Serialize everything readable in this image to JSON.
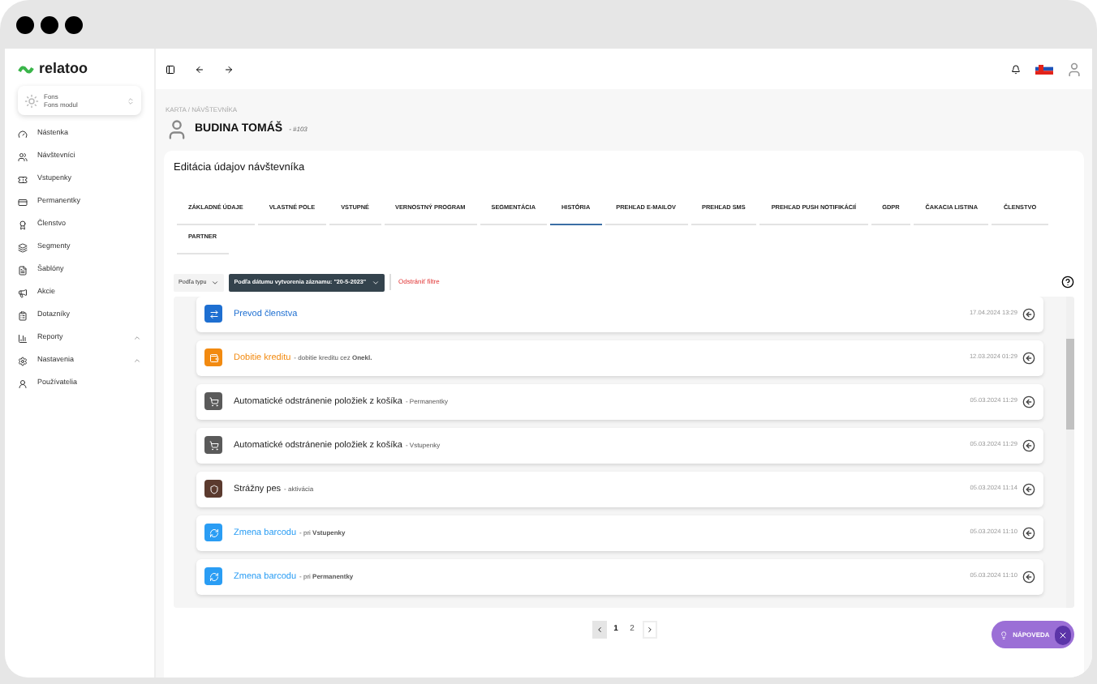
{
  "logo": {
    "text": "relatoo"
  },
  "module_switcher": {
    "title": "Fons",
    "subtitle": "Fons modul"
  },
  "sidebar": {
    "items": [
      {
        "label": "Nástenka",
        "expandable": false
      },
      {
        "label": "Návštevníci",
        "expandable": false
      },
      {
        "label": "Vstupenky",
        "expandable": false
      },
      {
        "label": "Permanentky",
        "expandable": false
      },
      {
        "label": "Členstvo",
        "expandable": false
      },
      {
        "label": "Segmenty",
        "expandable": false
      },
      {
        "label": "Šablóny",
        "expandable": false
      },
      {
        "label": "Akcie",
        "expandable": false
      },
      {
        "label": "Dotazníky",
        "expandable": false
      },
      {
        "label": "Reporty",
        "expandable": true
      },
      {
        "label": "Nastavenia",
        "expandable": true
      },
      {
        "label": "Používatelia",
        "expandable": false
      }
    ]
  },
  "breadcrumb": "KARTA / NÁVŠTEVNÍKA",
  "person": {
    "name": "BUDINA TOMÁŠ",
    "id": "- #103"
  },
  "card": {
    "title": "Editácia údajov návštevníka",
    "tabs": [
      {
        "label": "ZÁKLADNÉ ÚDAJE",
        "selected": false
      },
      {
        "label": "VLASTNÉ POLE",
        "selected": false
      },
      {
        "label": "VSTUPNÉ",
        "selected": false
      },
      {
        "label": "VERNOSTNÝ PROGRAM",
        "selected": false
      },
      {
        "label": "SEGMENTÁCIA",
        "selected": false
      },
      {
        "label": "HISTÓRIA",
        "selected": true
      },
      {
        "label": "PREHĽAD E-MAILOV",
        "selected": false
      },
      {
        "label": "PREHĽAD SMS",
        "selected": false
      },
      {
        "label": "PREHĽAD PUSH NOTIFIKÁCIÍ",
        "selected": false
      },
      {
        "label": "GDPR",
        "selected": false
      },
      {
        "label": "ČAKACIA LISTINA",
        "selected": false
      },
      {
        "label": "ČLENSTVO",
        "selected": false
      },
      {
        "label": "PARTNER",
        "selected": false
      }
    ],
    "filters": [
      {
        "label": "Podľa typu",
        "active": false
      },
      {
        "label": "Podľa dátumu vytvorenia záznamu: \"20-5-2023\"",
        "active": true
      }
    ],
    "remove_filters": "Odstrániť filtre",
    "history": [
      {
        "title": "Prevod členstva",
        "date": "17.04.2024 13:29",
        "color": "#1e6fd1",
        "kind": "colored"
      },
      {
        "title": "Dobitie kreditu",
        "detail": "- dobitie kreditu cez **Onekl.**",
        "date": "12.03.2024 01:29",
        "color": "#f28a10",
        "kind": "colored"
      },
      {
        "title": "Automatické odstránenie položiek z košíka",
        "detail": "- Permanentky",
        "date": "05.03.2024 11:29",
        "color": "#5a5a5a",
        "kind": "plain"
      },
      {
        "title": "Automatické odstránenie položiek z košíka",
        "detail": "- Vstupenky",
        "date": "05.03.2024 11:29",
        "color": "#5a5a5a",
        "kind": "plain"
      },
      {
        "title": "Strážny pes",
        "detail": "- aktivácia",
        "date": "05.03.2024 11:14",
        "color": "#5b3a2e",
        "kind": "plain"
      },
      {
        "title": "Zmena barcodu",
        "detail": "- pri **Vstupenky**",
        "date": "05.03.2024 11:10",
        "color": "#2a9df4",
        "kind": "colored"
      },
      {
        "title": "Zmena barcodu",
        "detail": "- pri **Permanentky**",
        "date": "05.03.2024 11:10",
        "color": "#2a9df4",
        "kind": "colored"
      }
    ],
    "pagination": [
      {
        "label": "1",
        "selected": true
      },
      {
        "label": "2",
        "selected": false
      }
    ]
  },
  "help_button": {
    "label": "NÁPOVEDA"
  }
}
